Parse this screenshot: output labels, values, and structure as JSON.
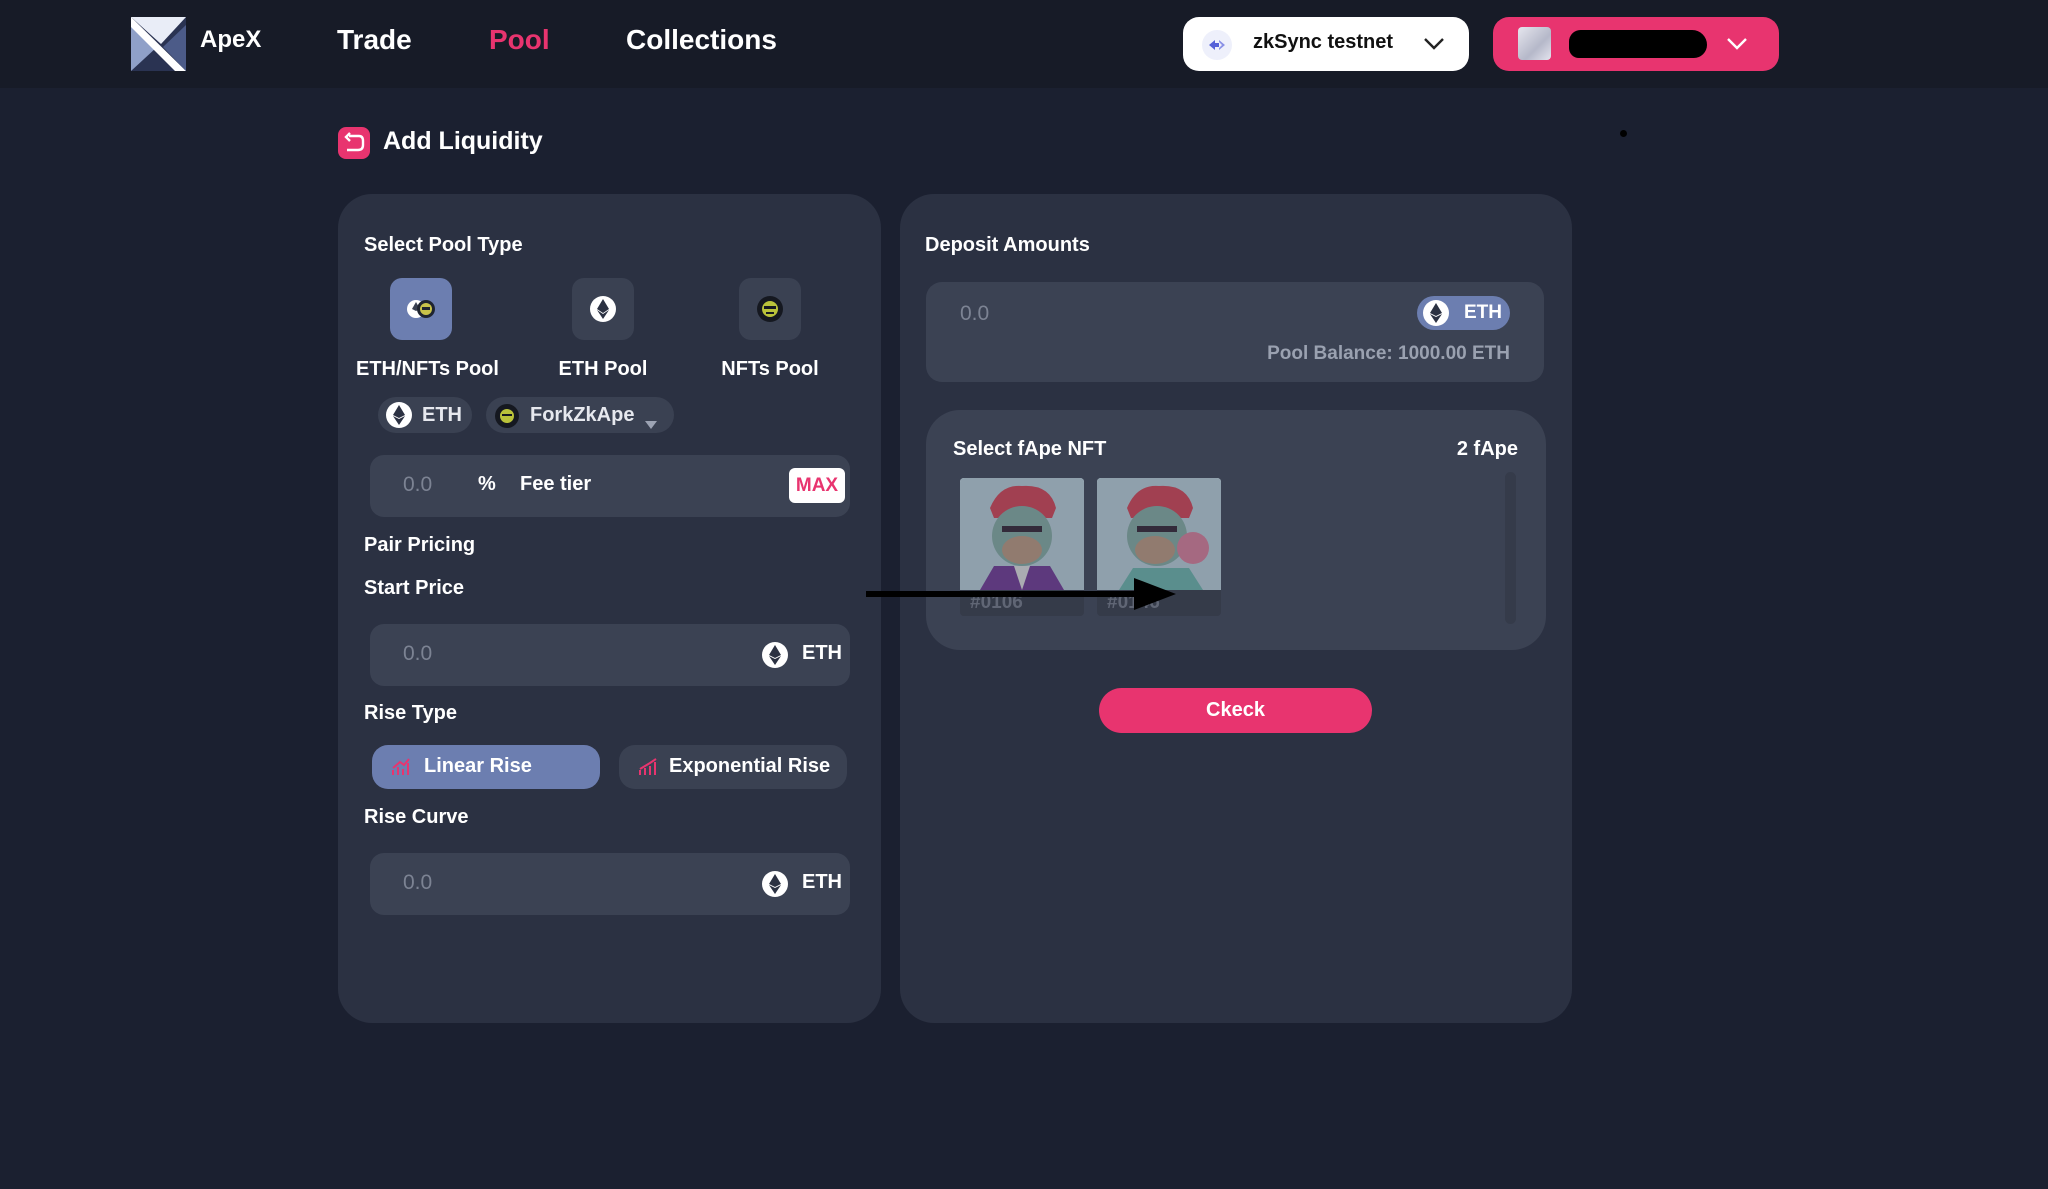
{
  "header": {
    "logo_text": "ApeX",
    "nav": [
      {
        "label": "Trade",
        "active": false
      },
      {
        "label": "Pool",
        "active": true
      },
      {
        "label": "Collections",
        "active": false
      }
    ],
    "network_label": "zkSync testnet",
    "accent_color": "#e8346f"
  },
  "page": {
    "title": "Add Liquidity"
  },
  "left_card": {
    "pool_type_label": "Select Pool Type",
    "pool_types": [
      {
        "label": "ETH/NFTs Pool",
        "selected": true,
        "icon": "eth-nft-icon"
      },
      {
        "label": "ETH Pool",
        "selected": false,
        "icon": "eth-icon"
      },
      {
        "label": "NFTs Pool",
        "selected": false,
        "icon": "ape-icon"
      }
    ],
    "token_chip": "ETH",
    "collection_chip": "ForkZkApe",
    "fee_placeholder": "0.0",
    "fee_percent": "%",
    "fee_label": "Fee tier",
    "max_label": "MAX",
    "pair_pricing_label": "Pair Pricing",
    "start_price_label": "Start Price",
    "start_price_placeholder": "0.0",
    "start_price_unit": "ETH",
    "rise_type_label": "Rise Type",
    "rise_types": [
      {
        "label": "Linear Rise",
        "selected": true
      },
      {
        "label": "Exponential Rise",
        "selected": false
      }
    ],
    "rise_curve_label": "Rise Curve",
    "rise_curve_placeholder": "0.0",
    "rise_curve_unit": "ETH"
  },
  "right_card": {
    "deposit_label": "Deposit Amounts",
    "deposit_placeholder": "0.0",
    "deposit_token": "ETH",
    "pool_balance": "Pool Balance: 1000.00 ETH",
    "nft_select_label": "Select fApe NFT",
    "nft_count": "2 fApe",
    "nfts": [
      {
        "id": "#0106"
      },
      {
        "id": "#0146"
      }
    ],
    "check_label": "Ckeck"
  }
}
